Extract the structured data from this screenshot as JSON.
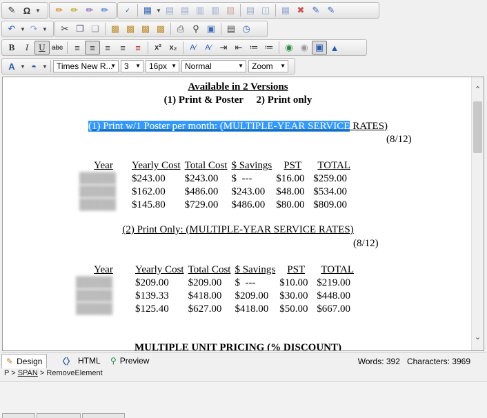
{
  "toolbar": {
    "row1_icons": [
      "edit-icon",
      "omega-icon",
      "chevron-down-icon",
      "highlighter-icon",
      "highlighter-icon",
      "highlighter-icon",
      "highlighter-icon",
      "spellcheck-icon",
      "table-icon",
      "chevron-down-icon",
      "insert-row-icon",
      "insert-row-icon",
      "insert-column-icon",
      "insert-column-icon",
      "delete-column-icon",
      "merge-cells-icon",
      "split-cells-icon",
      "table-props-icon",
      "delete-table-icon",
      "edit-cell-icon",
      "edit-table-icon"
    ],
    "row2_icons": [
      "undo-icon",
      "redo-icon",
      "cut-icon",
      "copy-icon",
      "paste-icon",
      "paste-text-icon",
      "paste-word-icon",
      "paste-html-icon",
      "clean-icon",
      "print-icon",
      "find-icon",
      "select-all-icon",
      "page-props-icon",
      "clock-icon"
    ],
    "bold": "B",
    "italic": "I",
    "underline": "U",
    "strike": "abc",
    "superscript": "x²",
    "subscript": "x₂",
    "font_name": "Times New R...",
    "font_size": "3",
    "font_px": "16px",
    "paragraph_style": "Normal",
    "zoom": "Zoom"
  },
  "document": {
    "heading1": "Available in 2 Versions",
    "heading2": "(1) Print & Poster     2) Print only",
    "section1_title_selected": "(1) Print w/1 Poster per month: (MULTIPLE-YEAR SERVICE",
    "section1_title_rest": "RATES)",
    "section1_date": "(8/12)",
    "table1": {
      "headers": [
        "Year",
        "Yearly Cost",
        "Total Cost",
        "$ Savings",
        "PST",
        "TOTAL"
      ],
      "rows": [
        [
          "",
          "$243.00",
          "$243.00",
          "$  ---",
          "$16.00",
          "$259.00"
        ],
        [
          "",
          "$162.00",
          "$486.00",
          "$243.00",
          "$48.00",
          "$534.00"
        ],
        [
          "",
          "$145.80",
          "$729.00",
          "$486.00",
          "$80.00",
          "$809.00"
        ]
      ]
    },
    "section2_title": "(2) Print Only: (MULTIPLE-YEAR SERVICE RATES)",
    "section2_date": "(8/12)",
    "table2": {
      "headers": [
        "Year",
        "Yearly Cost",
        "Total Cost",
        "$ Savings",
        "PST",
        "TOTAL"
      ],
      "rows": [
        [
          "",
          "$209.00",
          "$209.00",
          "$  ---",
          "$10.00",
          "$219.00"
        ],
        [
          "",
          "$139.33",
          "$418.00",
          "$209.00",
          "$30.00",
          "$448.00"
        ],
        [
          "",
          "$125.40",
          "$627.00",
          "$418.00",
          "$50.00",
          "$667.00"
        ]
      ]
    },
    "section3_title": "MULTIPLE UNIT PRICING (% DISCOUNT)"
  },
  "tabs": {
    "design": "Design",
    "html": "HTML",
    "preview": "Preview"
  },
  "counts": {
    "words": "Words: 392",
    "characters": "Characters: 3969"
  },
  "status": {
    "p": "P >",
    "span": "SPAN",
    "sep": ">",
    "remove": "RemoveElement"
  }
}
